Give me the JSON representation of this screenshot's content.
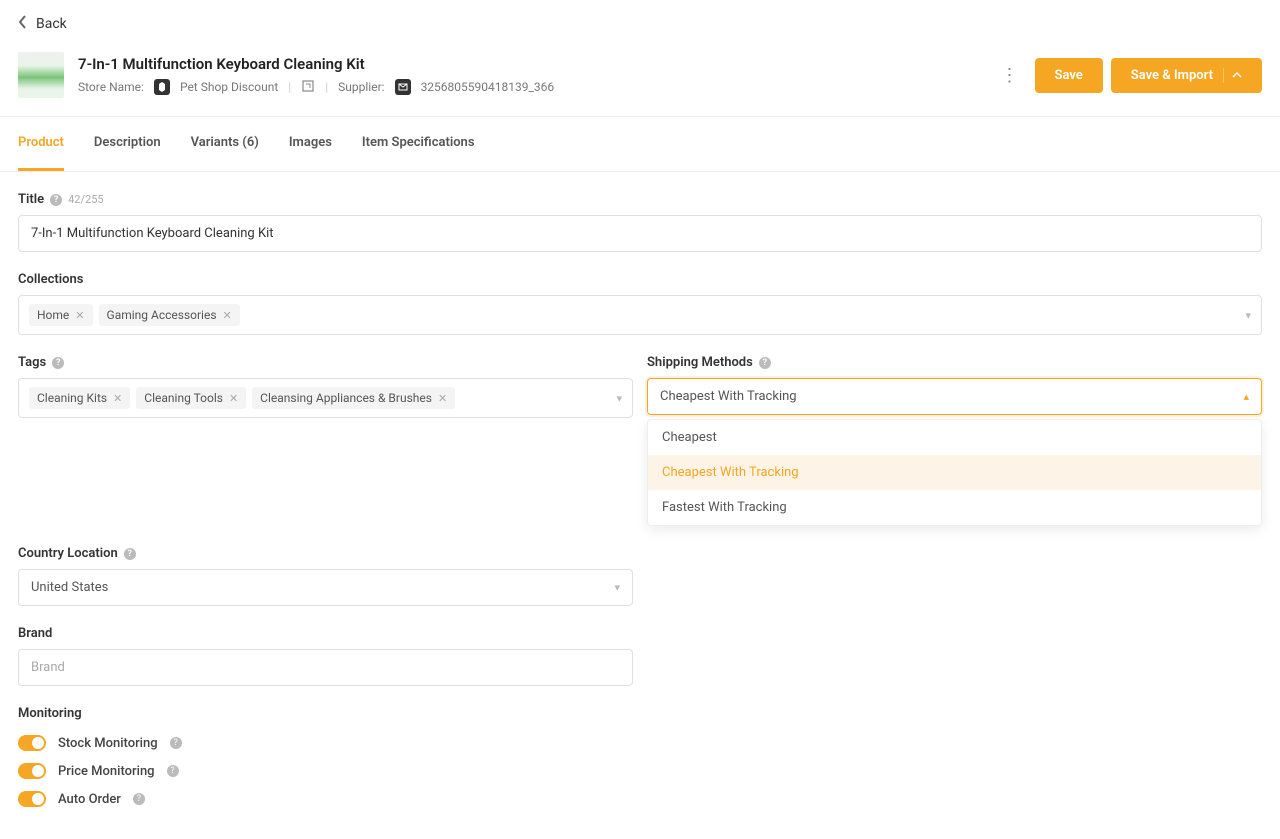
{
  "nav": {
    "back": "Back"
  },
  "header": {
    "title": "7-In-1 Multifunction Keyboard Cleaning Kit",
    "store_label": "Store Name:",
    "store_name": "Pet Shop Discount",
    "supplier_label": "Supplier:",
    "supplier_value": "3256805590418139_366",
    "save": "Save",
    "save_import": "Save & Import"
  },
  "tabs": {
    "product": "Product",
    "description": "Description",
    "variants": "Variants (6)",
    "images": "Images",
    "specs": "Item Specifications"
  },
  "title_field": {
    "label": "Title",
    "counter": "42/255",
    "value": "7-In-1 Multifunction Keyboard Cleaning Kit"
  },
  "collections": {
    "label": "Collections",
    "tags": [
      "Home",
      "Gaming Accessories"
    ]
  },
  "tags": {
    "label": "Tags",
    "items": [
      "Cleaning Kits",
      "Cleaning Tools",
      "Cleansing Appliances & Brushes"
    ]
  },
  "shipping": {
    "label": "Shipping Methods",
    "value": "Cheapest With Tracking",
    "options": [
      "Cheapest",
      "Cheapest With Tracking",
      "Fastest With Tracking"
    ]
  },
  "country": {
    "label": "Country Location",
    "value": "United States"
  },
  "brand": {
    "label": "Brand",
    "placeholder": "Brand"
  },
  "monitoring": {
    "label": "Monitoring",
    "stock": "Stock Monitoring",
    "price": "Price Monitoring",
    "auto": "Auto Order"
  }
}
